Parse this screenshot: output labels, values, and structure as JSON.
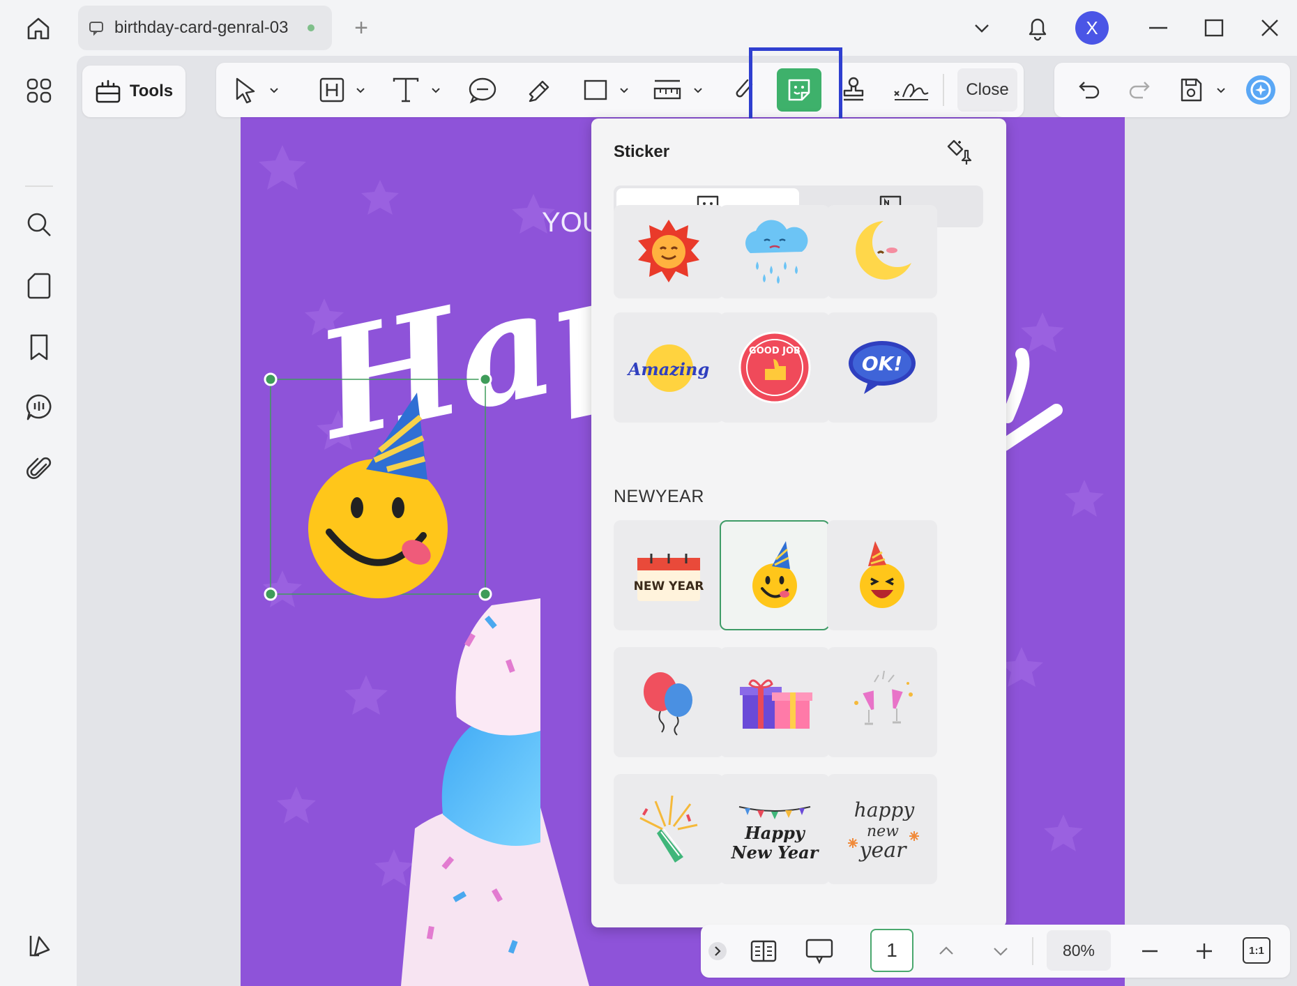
{
  "titlebar": {
    "tab_title": "birthday-card-genral-03",
    "add_tab": "+",
    "avatar_letter": "X"
  },
  "toolbar": {
    "tools_label": "Tools",
    "close_label": "Close"
  },
  "canvas": {
    "card_text_partial": "YOU",
    "headline_partial": "Happy"
  },
  "sticker_panel": {
    "title": "Sticker",
    "section_newyear": "NEWYEAR",
    "sticker_text_amazing": "Amazing",
    "sticker_text_good_job": "GOOD JOB",
    "sticker_text_ok": "OK!",
    "sticker_text_new_year_calendar": "NEW YEAR",
    "sticker_text_happy_new_year_1": "Happy",
    "sticker_text_happy_new_year_2": "New Year",
    "sticker_text_script_1": "happy",
    "sticker_text_script_2": "new",
    "sticker_text_script_3": "year"
  },
  "bottombar": {
    "page_number": "1",
    "zoom": "80%",
    "fit": "1:1"
  },
  "colors": {
    "accent_green": "#3eb16b",
    "highlight_blue": "#2f3fd0",
    "card_purple": "#8e53d9",
    "avatar_blue": "#4a55e6"
  }
}
